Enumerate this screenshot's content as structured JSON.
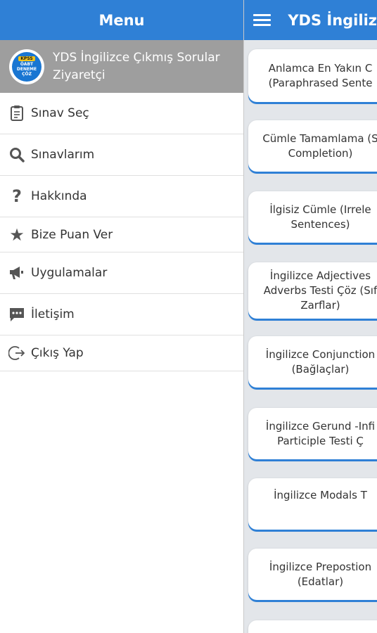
{
  "drawer": {
    "title": "Menu",
    "profile": {
      "logo_top": "KPSS",
      "logo_line1": "ÖABT",
      "logo_line2": "DENEME",
      "logo_line3": "ÇÖZ",
      "name": "YDS İngilizce Çıkmış Sorular",
      "role": "Ziyaretçi"
    },
    "items": [
      {
        "label": "Sınav Seç",
        "icon": "clipboard-icon"
      },
      {
        "label": "Sınavlarım",
        "icon": "search-icon"
      },
      {
        "label": "Hakkında",
        "icon": "question-icon"
      },
      {
        "label": "Bize Puan Ver",
        "icon": "star-icon"
      },
      {
        "label": "Uygulamalar",
        "icon": "megaphone-icon"
      },
      {
        "label": "İletişim",
        "icon": "chat-icon"
      },
      {
        "label": "Çıkış Yap",
        "icon": "logout-icon"
      }
    ]
  },
  "main": {
    "title": "YDS İngiliz",
    "cards": [
      {
        "line1": "Anlamca En Yakın C",
        "line2": "(Paraphrased Sente",
        "line3": ""
      },
      {
        "line1": "Cümle Tamamlama (S",
        "line2": "Completion)",
        "line3": ""
      },
      {
        "line1": "İlgisiz Cümle (Irrele",
        "line2": "Sentences)",
        "line3": ""
      },
      {
        "line1": "İngilizce Adjectives",
        "line2": "Adverbs Testi Çöz (Sıf",
        "line3": "Zarflar)"
      },
      {
        "line1": "İngilizce Conjunction",
        "line2": "(Bağlaçlar)",
        "line3": ""
      },
      {
        "line1": "İngilizce Gerund -Infi",
        "line2": "Participle Testi Ç",
        "line3": ""
      },
      {
        "line1": "İngilizce Modals T",
        "line2": "",
        "line3": ""
      },
      {
        "line1": "İngilizce Prepostion",
        "line2": "(Edatlar)",
        "line3": ""
      },
      {
        "line1": "",
        "line2": "",
        "line3": ""
      }
    ]
  },
  "colors": {
    "primary": "#2f80d6",
    "profile_bg": "#9e9e9e"
  }
}
